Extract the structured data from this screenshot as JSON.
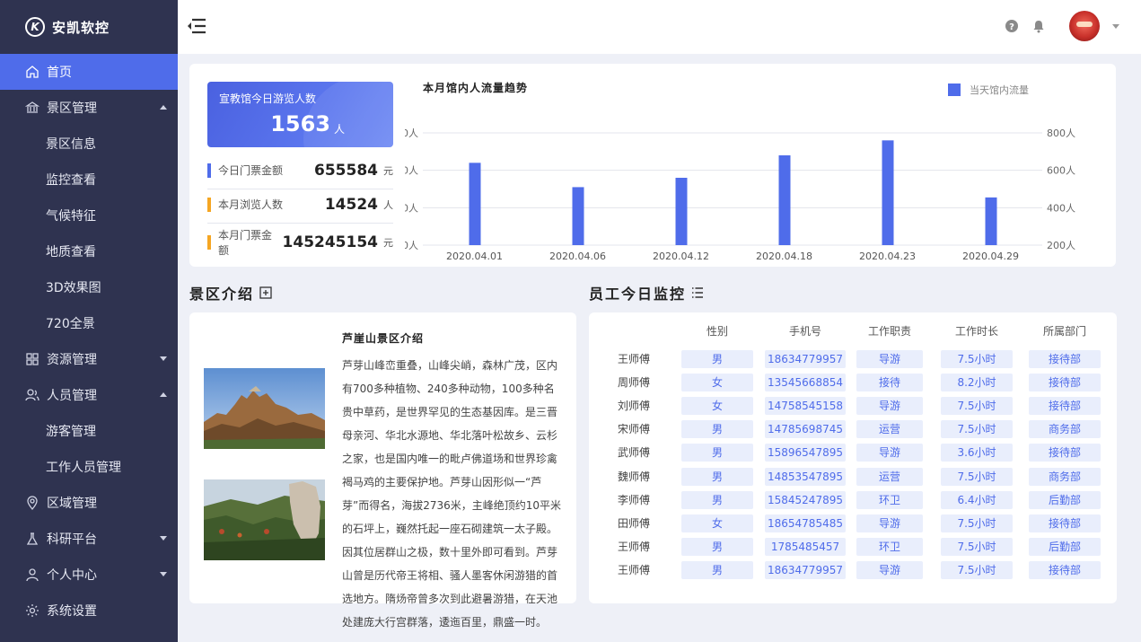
{
  "brand": {
    "name": "安凯软控",
    "logo_letter": "K"
  },
  "sidebar": {
    "items": [
      {
        "label": "首页",
        "icon": "home-icon",
        "active": true
      },
      {
        "label": "景区管理",
        "icon": "bank-icon",
        "expanded": true,
        "children": [
          "景区信息",
          "监控查看",
          "气候特征",
          "地质查看",
          "3D效果图",
          "720全景"
        ]
      },
      {
        "label": "资源管理",
        "icon": "grid-icon",
        "expanded": false
      },
      {
        "label": "人员管理",
        "icon": "users-icon",
        "expanded": true,
        "children": [
          "游客管理",
          "工作人员管理"
        ]
      },
      {
        "label": "区域管理",
        "icon": "location-icon"
      },
      {
        "label": "科研平台",
        "icon": "flask-icon",
        "expanded": false
      },
      {
        "label": "个人中心",
        "icon": "user-icon",
        "expanded": false
      },
      {
        "label": "系统设置",
        "icon": "gear-icon"
      }
    ]
  },
  "summary": {
    "visitor_title": "宣教馆今日游览人数",
    "visitor_count": "1563",
    "visitor_unit": "人",
    "stats": [
      {
        "label": "今日门票金额",
        "value": "655584",
        "unit": "元",
        "color": "#4f6cea"
      },
      {
        "label": "本月浏览人数",
        "value": "14524",
        "unit": "人",
        "color": "#f5a623"
      },
      {
        "label": "本月门票金额",
        "value": "145245154",
        "unit": "元",
        "color": "#f5a623"
      }
    ]
  },
  "chart_data": {
    "type": "bar",
    "title": "本月馆内人流量趋势",
    "categories": [
      "2020.04.01",
      "2020.04.06",
      "2020.04.12",
      "2020.04.18",
      "2020.04.23",
      "2020.04.29"
    ],
    "series": [
      {
        "name": "当天馆内流量",
        "values": [
          640,
          510,
          560,
          680,
          760,
          455
        ],
        "color": "#4f6cea"
      }
    ],
    "ylim": [
      200,
      800
    ],
    "yticks": [
      "200人",
      "400人",
      "600人",
      "800人"
    ],
    "grid": true,
    "legend": "top-right"
  },
  "intro": {
    "section_title": "景区介绍",
    "title": "芦崖山景区介绍",
    "text": "芦芽山峰峦重叠，山峰尖峭，森林广茂，区内有700多种植物、240多种动物，100多种名贵中草药，是世界罕见的生态基因库。是三晋母亲河、华北水源地、华北落叶松故乡、云杉之家，也是国内唯一的毗卢佛道场和世界珍禽褐马鸡的主要保护地。芦芽山因形似一“芦芽”而得名，海拔2736米，主峰绝顶约10平米的石坪上，巍然托起一座石砌建筑一太子殿。因其位居群山之极，数十里外即可看到。芦芽山曾是历代帝王将相、骚人墨客休闲游猎的首选地方。隋炀帝曾多次到此避暑游猎，在天池处建庞大行宫群落，逶迤百里，鼎盛一时。"
  },
  "staff": {
    "section_title": "员工今日监控",
    "columns": [
      "性别",
      "手机号",
      "工作职责",
      "工作时长",
      "所属部门"
    ],
    "rows": [
      [
        "王师傅",
        "男",
        "18634779957",
        "导游",
        "7.5小时",
        "接待部"
      ],
      [
        "周师傅",
        "女",
        "13545668854",
        "接待",
        "8.2小时",
        "接待部"
      ],
      [
        "刘师傅",
        "女",
        "14758545158",
        "导游",
        "7.5小时",
        "接待部"
      ],
      [
        "宋师傅",
        "男",
        "14785698745",
        "运营",
        "7.5小时",
        "商务部"
      ],
      [
        "武师傅",
        "男",
        "15896547895",
        "导游",
        "3.6小时",
        "接待部"
      ],
      [
        "魏师傅",
        "男",
        "14853547895",
        "运营",
        "7.5小时",
        "商务部"
      ],
      [
        "李师傅",
        "男",
        "15845247895",
        "环卫",
        "6.4小时",
        "后勤部"
      ],
      [
        "田师傅",
        "女",
        "18654785485",
        "导游",
        "7.5小时",
        "接待部"
      ],
      [
        "王师傅",
        "男",
        "1785485457",
        "环卫",
        "7.5小时",
        "后勤部"
      ],
      [
        "王师傅",
        "男",
        "18634779957",
        "导游",
        "7.5小时",
        "接待部"
      ]
    ]
  }
}
